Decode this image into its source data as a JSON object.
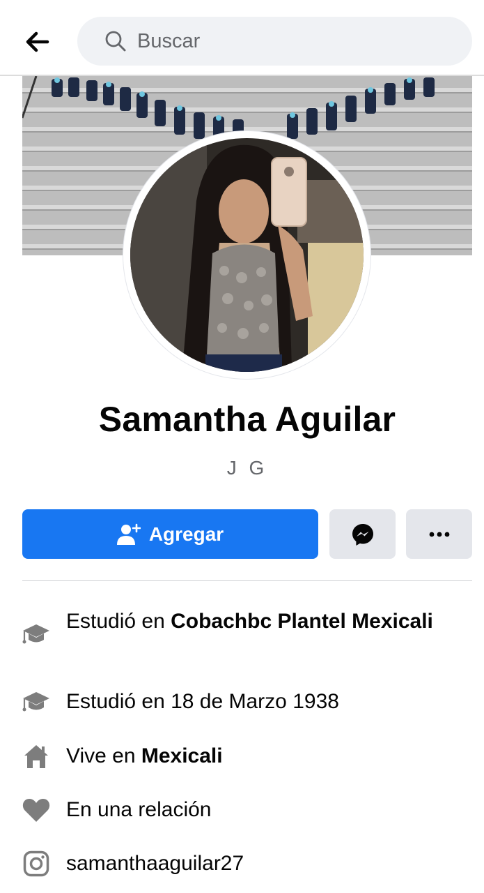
{
  "search": {
    "placeholder": "Buscar"
  },
  "profile": {
    "name": "Samantha Aguilar",
    "nickname": "J G"
  },
  "actions": {
    "add_label": "Agregar"
  },
  "info": [
    {
      "icon": "graduation-cap-icon",
      "prefix": "Estudió en ",
      "bold": "Cobachbc Plantel Mexicali"
    },
    {
      "icon": "graduation-cap-icon",
      "prefix": "Estudió en 18 de Marzo 1938",
      "bold": ""
    },
    {
      "icon": "home-icon",
      "prefix": "Vive en ",
      "bold": "Mexicali"
    },
    {
      "icon": "heart-icon",
      "prefix": "En una relación",
      "bold": ""
    },
    {
      "icon": "instagram-icon",
      "prefix": "samanthaaguilar27",
      "bold": ""
    }
  ],
  "colors": {
    "accent": "#1877f2",
    "icon_gray": "#7d7d7d",
    "secondary_text": "#65676b",
    "button_gray": "#e4e6eb"
  }
}
